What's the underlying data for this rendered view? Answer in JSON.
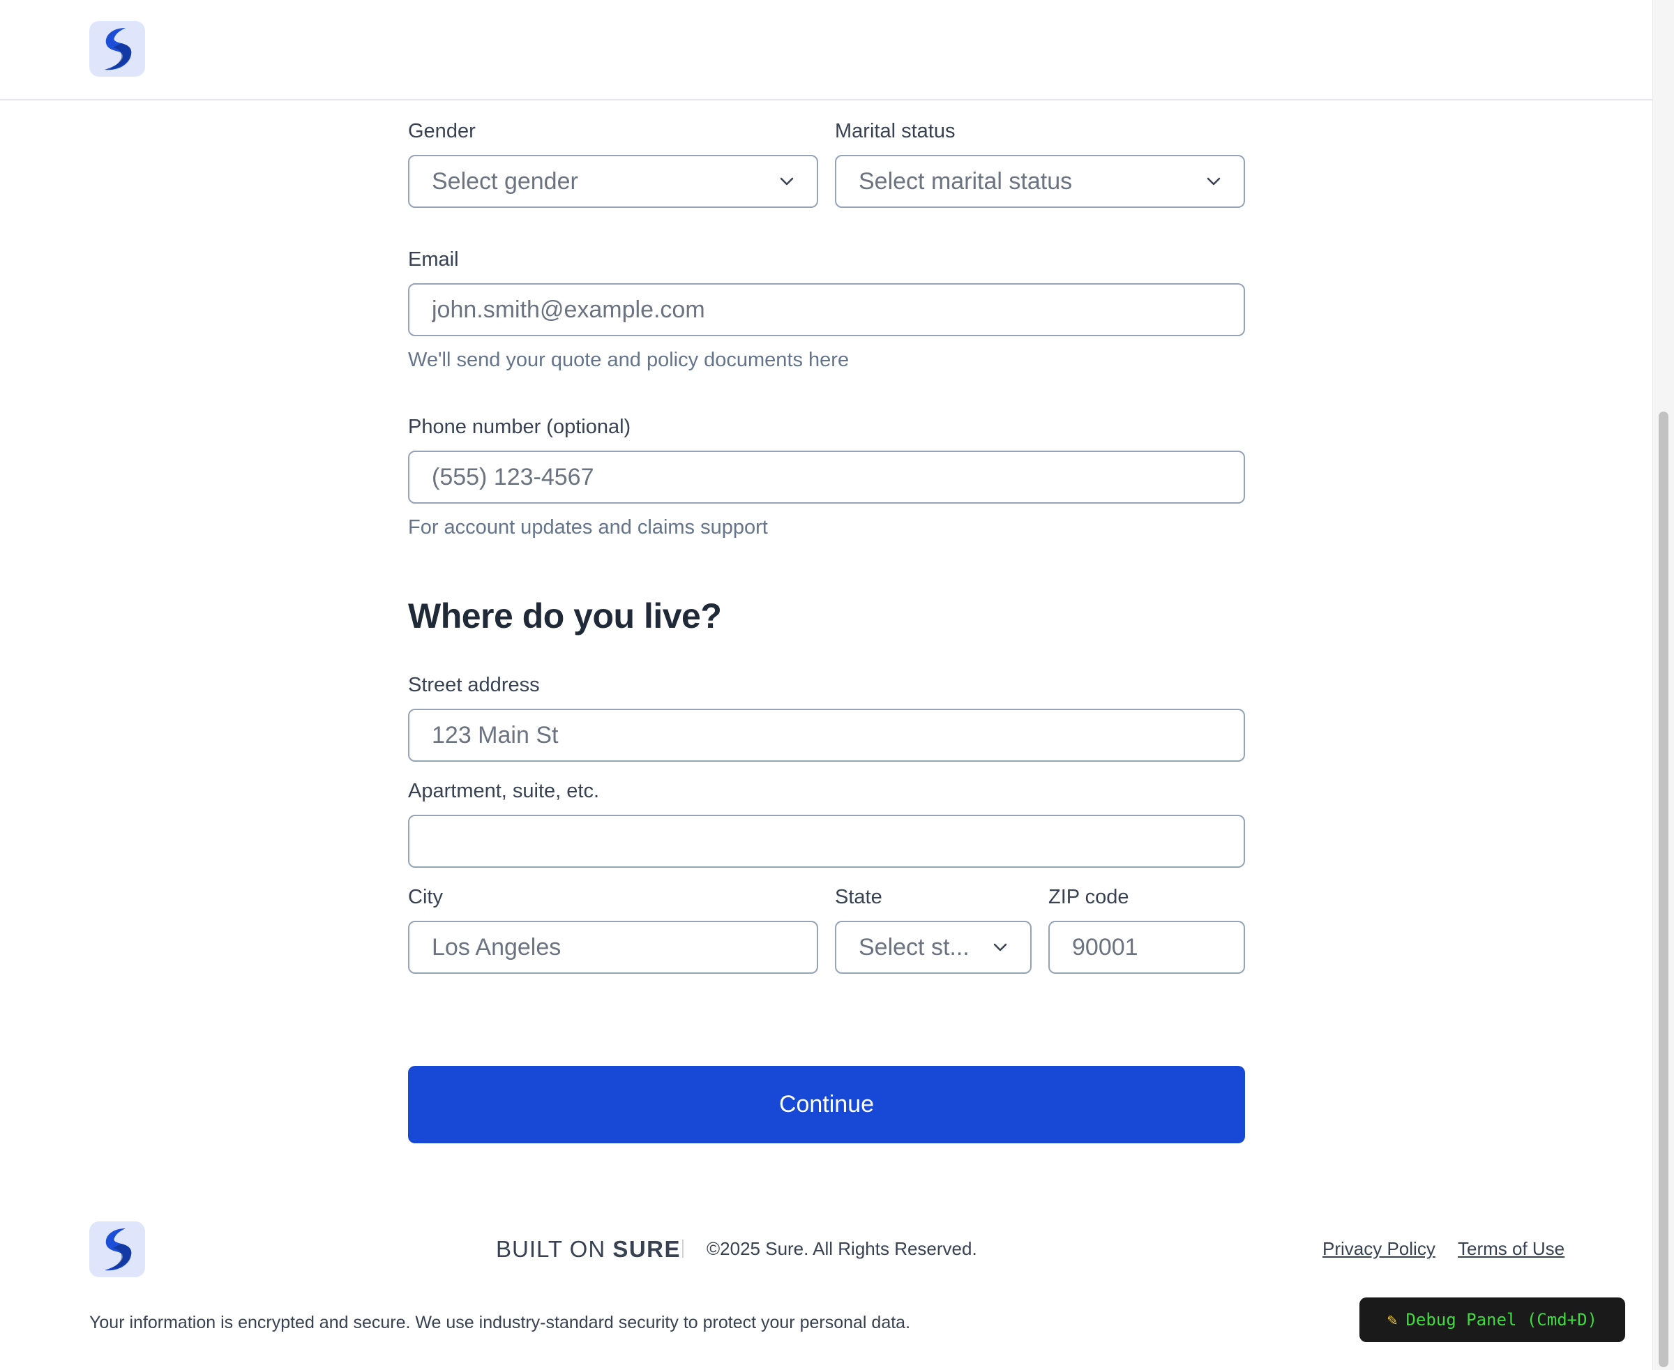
{
  "brand": {
    "logo_icon": "sure-s-logo-icon",
    "accent": "#1749d6",
    "logo_bg": "#dfe6fb"
  },
  "form": {
    "gender": {
      "label": "Gender",
      "placeholder": "Select gender"
    },
    "marital_status": {
      "label": "Marital status",
      "placeholder": "Select marital status"
    },
    "email": {
      "label": "Email",
      "placeholder": "john.smith@example.com",
      "help": "We'll send your quote and policy documents here"
    },
    "phone": {
      "label": "Phone number (optional)",
      "placeholder": "(555) 123-4567",
      "help": "For account updates and claims support"
    }
  },
  "address": {
    "title": "Where do you live?",
    "street": {
      "label": "Street address",
      "placeholder": "123 Main St"
    },
    "apartment": {
      "label": "Apartment, suite, etc.",
      "placeholder": ""
    },
    "city": {
      "label": "City",
      "placeholder": "Los Angeles"
    },
    "state": {
      "label": "State",
      "placeholder": "Select st..."
    },
    "zip": {
      "label": "ZIP code",
      "placeholder": "90001"
    }
  },
  "continue_label": "Continue",
  "footer": {
    "built_on_prefix": "BUILT ON",
    "built_on_brand": "SURE",
    "copyright": "©2025 Sure. All Rights Reserved.",
    "privacy": "Privacy Policy",
    "terms": "Terms of Use",
    "security_note": "Your information is encrypted and secure. We use industry-standard security to protect your personal data."
  },
  "debug": {
    "icon": "bug-icon",
    "label": "Debug Panel (Cmd+D)"
  }
}
